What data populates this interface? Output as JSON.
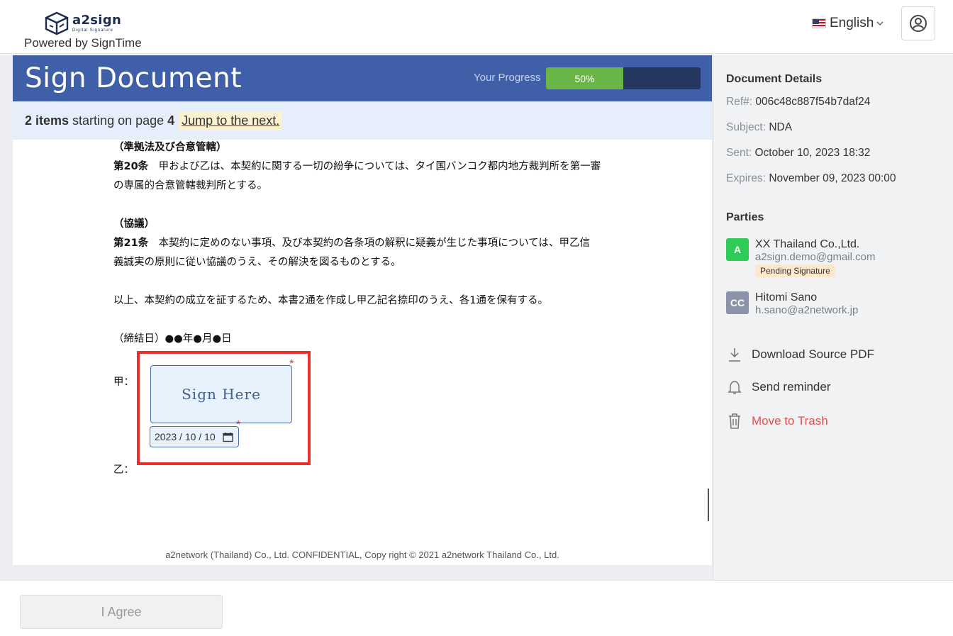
{
  "header": {
    "logo_name": "a2sign",
    "logo_tagline": "Digital Signature",
    "powered_by": "Powered by SignTime",
    "language": "English",
    "language_flag_icon": "us-flag-icon",
    "user_icon": "user-circle-icon"
  },
  "doc_header": {
    "title": "Sign Document",
    "progress_label": "Your Progress",
    "progress_text": "50%",
    "progress_value": 0.5,
    "progress_color": "#6ab548"
  },
  "notice": {
    "count": "2 items",
    "mid": " starting on page ",
    "page": "4",
    "jump": "Jump to the next."
  },
  "document": {
    "h1": "（準拠法及び合意管轄）",
    "art20_num": "第20条",
    "art20_text": "　甲および乙は、本契約に関する一切の紛争については、タイ国バンコク都内地方裁判所を第一審",
    "art20_text2": "の専属的合意管轄裁判所とする。",
    "h2": "（協議）",
    "art21_num": "第21条",
    "art21_text": "　本契約に定めのない事項、及び本契約の各条項の解釈に疑義が生じた事項については、甲乙信",
    "art21_text2": "義誠実の原則に従い協議のうえ、その解決を図るものとする。",
    "closing": "以上、本契約の成立を証するため、本書2通を作成し甲乙記名捺印のうえ、各1通を保有する。",
    "date_line": "（締結日）●●年●月●日",
    "party_a_label": "甲：",
    "party_b_label": "乙：",
    "sign_here": "Sign Here",
    "date_value": "2023 / 10 / 10",
    "required_mark": "*",
    "footer": "a2network (Thailand) Co., Ltd. CONFIDENTIAL, Copy right © 2021 a2network Thailand Co., Ltd."
  },
  "bottom": {
    "agree": "I Agree"
  },
  "sidebar": {
    "details_title": "Document Details",
    "ref_k": "Ref#: ",
    "ref_v": "006c48c887f54b7daf24",
    "subject_k": "Subject: ",
    "subject_v": "NDA",
    "sent_k": "Sent: ",
    "sent_v": "October 10, 2023 18:32",
    "expires_k": "Expires: ",
    "expires_v": "November 09, 2023 00:00",
    "parties_title": "Parties",
    "parties": [
      {
        "initials": "A",
        "name": "XX Thailand Co.,Ltd.",
        "email": "a2sign.demo@gmail.com",
        "status": "Pending Signature",
        "color": "#2ecc57"
      },
      {
        "initials": "CC",
        "name": "Hitomi Sano",
        "email": "h.sano@a2network.jp",
        "status": "",
        "color": "#8a93a8"
      }
    ],
    "actions": {
      "download": "Download Source PDF",
      "reminder": "Send reminder",
      "trash": "Move to Trash"
    }
  }
}
